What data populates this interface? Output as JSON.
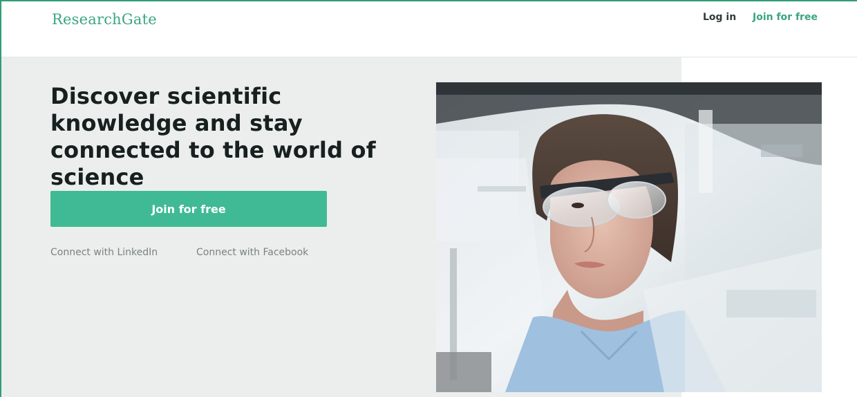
{
  "header": {
    "logo_text": "ResearchGate",
    "login_label": "Log in",
    "join_label": "Join for free"
  },
  "hero": {
    "title": "Discover scientific knowledge and stay connected to the world of science",
    "join_button_label": "Join for free",
    "connect_linkedin": "Connect with LinkedIn",
    "connect_facebook": "Connect with Facebook"
  },
  "colors": {
    "brand": "#40ba94",
    "hero_bg": "#ebeeed",
    "text_dark": "#17201f",
    "text_muted": "#7a8280"
  }
}
